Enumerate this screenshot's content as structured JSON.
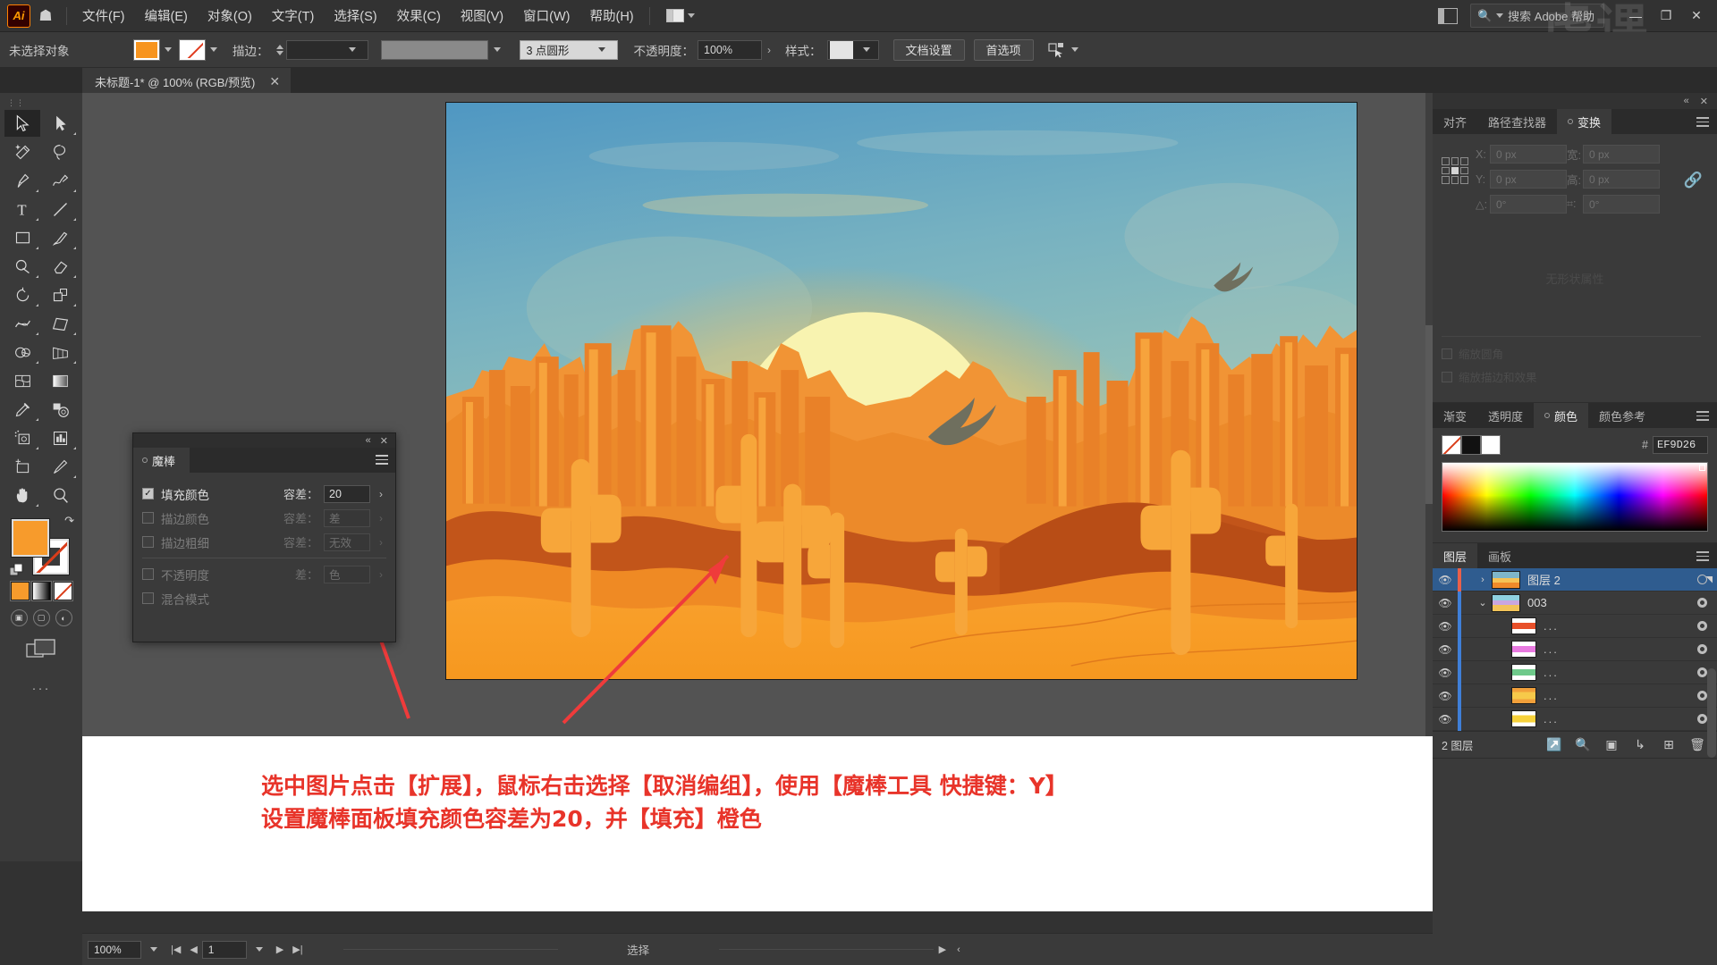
{
  "app": {
    "name": "Adobe Illustrator",
    "logo_text": "Ai"
  },
  "menubar": {
    "items": [
      "文件(F)",
      "编辑(E)",
      "对象(O)",
      "文字(T)",
      "选择(S)",
      "效果(C)",
      "视图(V)",
      "窗口(W)",
      "帮助(H)"
    ],
    "search_placeholder": "搜索 Adobe 帮助",
    "window_buttons": [
      "—",
      "❐",
      "✕"
    ],
    "watermark": "虎课网"
  },
  "controlbar": {
    "selection_status": "未选择对象",
    "fill_color": "#F7941E",
    "stroke_label": "描边：",
    "stroke_weight": "",
    "profile": "3 点圆形",
    "opacity_label": "不透明度：",
    "opacity_value": "100%",
    "style_label": "样式：",
    "doc_setup_button": "文档设置",
    "preferences_button": "首选项"
  },
  "document_tab": {
    "title": "未标题-1* @ 100% (RGB/预览)",
    "close": "✕"
  },
  "toolbar": {
    "tools": [
      {
        "name": "selection-tool",
        "label": "选择工具",
        "active": true
      },
      {
        "name": "direct-selection-tool",
        "label": "直接选择工具",
        "active": false
      },
      {
        "name": "magic-wand-tool",
        "label": "魔棒工具",
        "active": false
      },
      {
        "name": "lasso-tool",
        "label": "套索工具",
        "active": false
      },
      {
        "name": "pen-tool",
        "label": "钢笔工具",
        "active": false
      },
      {
        "name": "curvature-tool",
        "label": "曲率工具",
        "active": false
      },
      {
        "name": "type-tool",
        "label": "文字工具",
        "active": false
      },
      {
        "name": "line-segment-tool",
        "label": "直线段工具",
        "active": false
      },
      {
        "name": "rectangle-tool",
        "label": "矩形工具",
        "active": false
      },
      {
        "name": "paintbrush-tool",
        "label": "画笔工具",
        "active": false
      },
      {
        "name": "shaper-tool",
        "label": "Shaper 工具",
        "active": false
      },
      {
        "name": "eraser-tool",
        "label": "橡皮擦工具",
        "active": false
      },
      {
        "name": "rotate-tool",
        "label": "旋转工具",
        "active": false
      },
      {
        "name": "scale-tool",
        "label": "比例缩放工具",
        "active": false
      },
      {
        "name": "width-tool",
        "label": "宽度工具",
        "active": false
      },
      {
        "name": "free-transform-tool",
        "label": "自由变换工具",
        "active": false
      },
      {
        "name": "shape-builder-tool",
        "label": "形状生成器工具",
        "active": false
      },
      {
        "name": "perspective-grid-tool",
        "label": "透视网格工具",
        "active": false
      },
      {
        "name": "mesh-tool",
        "label": "网格工具",
        "active": false
      },
      {
        "name": "gradient-tool",
        "label": "渐变工具",
        "active": false
      },
      {
        "name": "eyedropper-tool",
        "label": "吸管工具",
        "active": false
      },
      {
        "name": "blend-tool",
        "label": "混合工具",
        "active": false
      },
      {
        "name": "symbol-sprayer-tool",
        "label": "符号喷枪工具",
        "active": false
      },
      {
        "name": "column-graph-tool",
        "label": "柱形图工具",
        "active": false
      },
      {
        "name": "artboard-tool",
        "label": "画板工具",
        "active": false
      },
      {
        "name": "slice-tool",
        "label": "切片工具",
        "active": false
      },
      {
        "name": "hand-tool",
        "label": "抓手工具",
        "active": false
      },
      {
        "name": "zoom-tool",
        "label": "缩放工具",
        "active": false
      }
    ],
    "fill_color": "#F79B2C",
    "stroke_color": "#FFFFFF",
    "more_tools": "···"
  },
  "magic_wand_panel": {
    "tab_label": "魔棒",
    "rows": [
      {
        "label": "填充颜色",
        "checked": true,
        "enabled": true,
        "tol_label": "容差：",
        "tol_value": "20"
      },
      {
        "label": "描边颜色",
        "checked": false,
        "enabled": false,
        "tol_label": "容差：",
        "tol_value": "差"
      },
      {
        "label": "描边粗细",
        "checked": false,
        "enabled": false,
        "tol_label": "容差：",
        "tol_value": "无效"
      },
      {
        "label": "不透明度",
        "checked": false,
        "enabled": false,
        "tol_label": "差：",
        "tol_value": "色"
      },
      {
        "label": "混合模式",
        "checked": false,
        "enabled": false,
        "tol_label": "",
        "tol_value": ""
      }
    ]
  },
  "transform_panel": {
    "tabs": [
      "对齐",
      "路径查找器",
      "变换"
    ],
    "active_tab": "变换",
    "fields": [
      {
        "key": "X:",
        "value": "0 px"
      },
      {
        "key": "宽:",
        "value": "0 px"
      },
      {
        "key": "Y:",
        "value": "0 px"
      },
      {
        "key": "高:",
        "value": "0 px"
      }
    ],
    "angle_key": "△:",
    "angle_value": "0°",
    "shear_key": "⌗:",
    "shear_value": "0°",
    "no_props": "无形状属性",
    "options": [
      "缩放圆角",
      "缩放描边和效果"
    ]
  },
  "color_panel": {
    "tabs": [
      "渐变",
      "透明度",
      "颜色",
      "颜色参考"
    ],
    "active_tab": "颜色",
    "hash": "#",
    "hex": "EF9D26"
  },
  "layers_panel": {
    "tabs": [
      "图层",
      "画板"
    ],
    "active_tab": "图层",
    "rows": [
      {
        "name": "图层 2",
        "selected": true,
        "twisty": "›",
        "indent": 0,
        "thumb": "artwork",
        "thumb_colors": [
          "#7fb6c9",
          "#f6c255",
          "#ef8a2a"
        ]
      },
      {
        "name": "003",
        "selected": false,
        "twisty": "⌄",
        "indent": 0,
        "thumb": "group",
        "thumb_colors": [
          "#8fd0e0",
          "#c9a6e0",
          "#f2c35a"
        ]
      },
      {
        "name": "...",
        "selected": false,
        "twisty": "",
        "indent": 1,
        "thumb": "path",
        "thumb_colors": [
          "#ffffff",
          "#e8502a",
          "#ffffff"
        ]
      },
      {
        "name": "...",
        "selected": false,
        "twisty": "",
        "indent": 1,
        "thumb": "path",
        "thumb_colors": [
          "#ffffff",
          "#e87ae0",
          "#ffffff"
        ]
      },
      {
        "name": "...",
        "selected": false,
        "twisty": "",
        "indent": 1,
        "thumb": "path",
        "thumb_colors": [
          "#ffffff",
          "#6ec98a",
          "#ffffff"
        ]
      },
      {
        "name": "...",
        "selected": false,
        "twisty": "",
        "indent": 1,
        "thumb": "path",
        "thumb_colors": [
          "#f2a03a",
          "#f7c94a",
          "#f2a03a"
        ]
      },
      {
        "name": "...",
        "selected": false,
        "twisty": "",
        "indent": 1,
        "thumb": "path",
        "thumb_colors": [
          "#ffffff",
          "#f7d13a",
          "#ffffff"
        ]
      }
    ],
    "footer_count": "2 图层",
    "footer_buttons": [
      "release-to-layers",
      "locate-object",
      "make-clipping-mask",
      "create-sublayer",
      "create-new-layer",
      "delete-selection"
    ]
  },
  "annotation": {
    "line1": "选中图片点击【扩展】，鼠标右击选择【取消编组】，使用【魔棒工具 快捷键：Y】",
    "line2": "设置魔棒面板填充颜色容差为20，并【填充】橙色",
    "color": "#E8342A"
  },
  "statusbar": {
    "zoom": "100%",
    "page": "1",
    "status": "选择",
    "nav_first": "|◀",
    "nav_prev": "◀",
    "nav_next": "▶",
    "nav_last": "▶|"
  },
  "artwork": {
    "title": "沙漠日落插画",
    "description": "Desert sunset illustration with cacti, mesas, sun and birds",
    "colors": {
      "sky_top": "#5a9ec4",
      "sky_mid": "#8dc0c4",
      "sun": "#f7f0a8",
      "sun_glow": "#f5c95a",
      "mesa_light": "#f9a23c",
      "mesa_mid": "#f08c2e",
      "dune_dark": "#c85a1e",
      "sand": "#f79a25",
      "cactus": "#f7a63a",
      "bird": "#6b6b5c"
    }
  }
}
